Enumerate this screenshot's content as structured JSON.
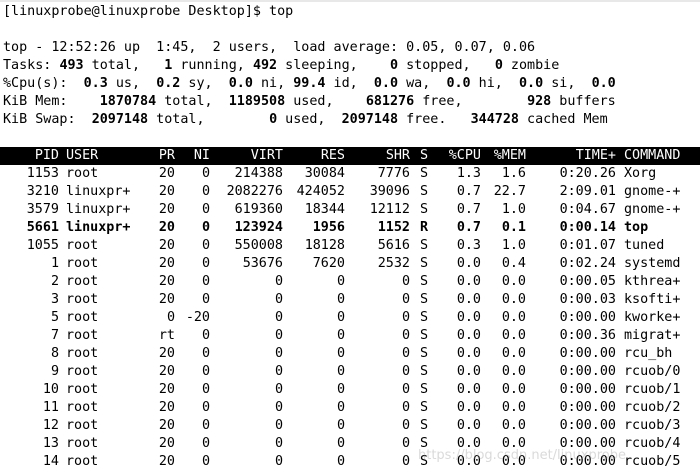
{
  "prompt_line": "[linuxprobe@linuxprobe Desktop]$ top",
  "summary": {
    "uptime_line": "top - 12:52:26 up  1:45,  2 users,  load average: 0.05, 0.07, 0.06",
    "tasks": {
      "label": "Tasks:",
      "total": "493",
      "total_label": " total,",
      "running": "1",
      "running_label": " running,",
      "sleeping": "492",
      "sleeping_label": " sleeping,",
      "stopped": "0",
      "stopped_label": " stopped,",
      "zombie": "0",
      "zombie_label": " zombie"
    },
    "cpu": {
      "label": "%Cpu(s):",
      "us": "0.3",
      "us_label": " us,",
      "sy": "0.2",
      "sy_label": " sy,",
      "ni": "0.0",
      "ni_label": " ni,",
      "id": "99.4",
      "id_label": " id,",
      "wa": "0.0",
      "wa_label": " wa,",
      "hi": "0.0",
      "hi_label": " hi,",
      "si": "0.0",
      "si_label": " si,",
      "st": "0.0"
    },
    "mem": {
      "label": "KiB Mem:",
      "total": "1870784",
      "total_label": " total,",
      "used": "1189508",
      "used_label": " used,",
      "free": "681276",
      "free_label": " free,",
      "buffers": "928",
      "buffers_label": " buffers"
    },
    "swap": {
      "label": "KiB Swap:",
      "total": "2097148",
      "total_label": " total,",
      "used": "0",
      "used_label": " used,",
      "free": "2097148",
      "free_label": " free.",
      "cached": "344728",
      "cached_label": " cached Mem"
    }
  },
  "table": {
    "headers": [
      "PID",
      "USER",
      "PR",
      "NI",
      "VIRT",
      "RES",
      "SHR",
      "S",
      "%CPU",
      "%MEM",
      "TIME+",
      "COMMAND"
    ],
    "rows": [
      [
        "1153",
        "root",
        "20",
        "0",
        "214388",
        "30084",
        "7776",
        "S",
        "1.3",
        "1.6",
        "0:20.26",
        "Xorg"
      ],
      [
        "3210",
        "linuxpr+",
        "20",
        "0",
        "2082276",
        "424052",
        "39096",
        "S",
        "0.7",
        "22.7",
        "2:09.01",
        "gnome-+"
      ],
      [
        "3579",
        "linuxpr+",
        "20",
        "0",
        "619360",
        "18344",
        "12112",
        "S",
        "0.7",
        "1.0",
        "0:04.67",
        "gnome-+"
      ],
      [
        "5661",
        "linuxpr+",
        "20",
        "0",
        "123924",
        "1956",
        "1152",
        "R",
        "0.7",
        "0.1",
        "0:00.14",
        "top"
      ],
      [
        "1055",
        "root",
        "20",
        "0",
        "550008",
        "18128",
        "5616",
        "S",
        "0.3",
        "1.0",
        "0:01.07",
        "tuned"
      ],
      [
        "1",
        "root",
        "20",
        "0",
        "53676",
        "7620",
        "2532",
        "S",
        "0.0",
        "0.4",
        "0:02.24",
        "systemd"
      ],
      [
        "2",
        "root",
        "20",
        "0",
        "0",
        "0",
        "0",
        "S",
        "0.0",
        "0.0",
        "0:00.05",
        "kthrea+"
      ],
      [
        "3",
        "root",
        "20",
        "0",
        "0",
        "0",
        "0",
        "S",
        "0.0",
        "0.0",
        "0:00.03",
        "ksofti+"
      ],
      [
        "5",
        "root",
        "0",
        "-20",
        "0",
        "0",
        "0",
        "S",
        "0.0",
        "0.0",
        "0:00.00",
        "kworke+"
      ],
      [
        "7",
        "root",
        "rt",
        "0",
        "0",
        "0",
        "0",
        "S",
        "0.0",
        "0.0",
        "0:00.36",
        "migrat+"
      ],
      [
        "8",
        "root",
        "20",
        "0",
        "0",
        "0",
        "0",
        "S",
        "0.0",
        "0.0",
        "0:00.00",
        "rcu_bh"
      ],
      [
        "9",
        "root",
        "20",
        "0",
        "0",
        "0",
        "0",
        "S",
        "0.0",
        "0.0",
        "0:00.00",
        "rcuob/0"
      ],
      [
        "10",
        "root",
        "20",
        "0",
        "0",
        "0",
        "0",
        "S",
        "0.0",
        "0.0",
        "0:00.00",
        "rcuob/1"
      ],
      [
        "11",
        "root",
        "20",
        "0",
        "0",
        "0",
        "0",
        "S",
        "0.0",
        "0.0",
        "0:00.00",
        "rcuob/2"
      ],
      [
        "12",
        "root",
        "20",
        "0",
        "0",
        "0",
        "0",
        "S",
        "0.0",
        "0.0",
        "0:00.00",
        "rcuob/3"
      ],
      [
        "13",
        "root",
        "20",
        "0",
        "0",
        "0",
        "0",
        "S",
        "0.0",
        "0.0",
        "0:00.00",
        "rcuob/4"
      ],
      [
        "14",
        "root",
        "20",
        "0",
        "0",
        "0",
        "0",
        "S",
        "0.0",
        "0.0",
        "0:00.00",
        "rcuob/5"
      ]
    ],
    "highlighted_row_index": 3
  },
  "watermark": "https://blog.csdn.net/linuxprobe"
}
